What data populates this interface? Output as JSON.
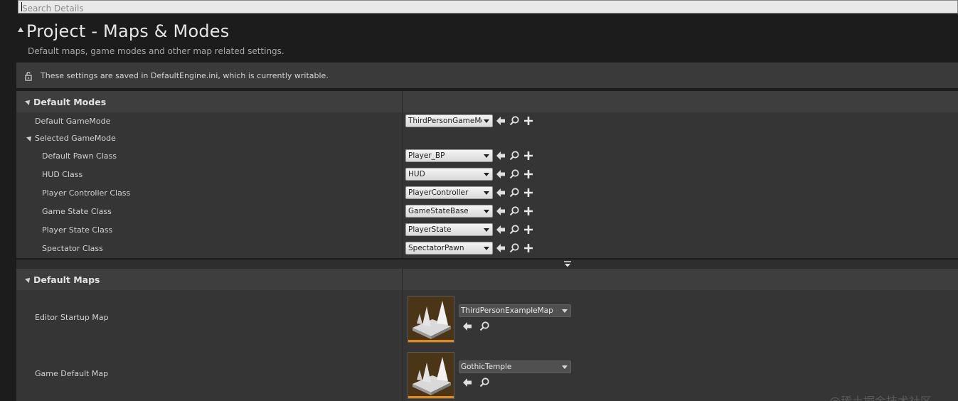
{
  "search": {
    "placeholder": "Search Details"
  },
  "page": {
    "title": "Project - Maps & Modes",
    "description": "Default maps, game modes and other map related settings."
  },
  "notice": {
    "text": "These settings are saved in DefaultEngine.ini, which is currently writable."
  },
  "default_modes": {
    "title": "Default Modes",
    "default_gamemode": {
      "label": "Default GameMode",
      "value": "ThirdPersonGameMo"
    },
    "selected_gamemode": {
      "label": "Selected GameMode",
      "rows": [
        {
          "label": "Default Pawn Class",
          "value": "Player_BP"
        },
        {
          "label": "HUD Class",
          "value": "HUD"
        },
        {
          "label": "Player Controller Class",
          "value": "PlayerController"
        },
        {
          "label": "Game State Class",
          "value": "GameStateBase"
        },
        {
          "label": "Player State Class",
          "value": "PlayerState"
        },
        {
          "label": "Spectator Class",
          "value": "SpectatorPawn"
        }
      ]
    }
  },
  "default_maps": {
    "title": "Default Maps",
    "rows": [
      {
        "label": "Editor Startup Map",
        "value": "ThirdPersonExampleMap"
      },
      {
        "label": "Game Default Map",
        "value": "GothicTemple"
      }
    ]
  },
  "watermark": "@稀土掘金技术社区",
  "colors": {
    "panel": "#3e3e3e",
    "rows": "#353535",
    "accent": "#e8890c",
    "background": "#1c1c1c"
  },
  "icons": [
    "lock-icon",
    "use-selected-arrow-icon",
    "browse-search-icon",
    "add-plus-icon",
    "collapse-arrow-icon",
    "map-thumbnail-icon"
  ]
}
